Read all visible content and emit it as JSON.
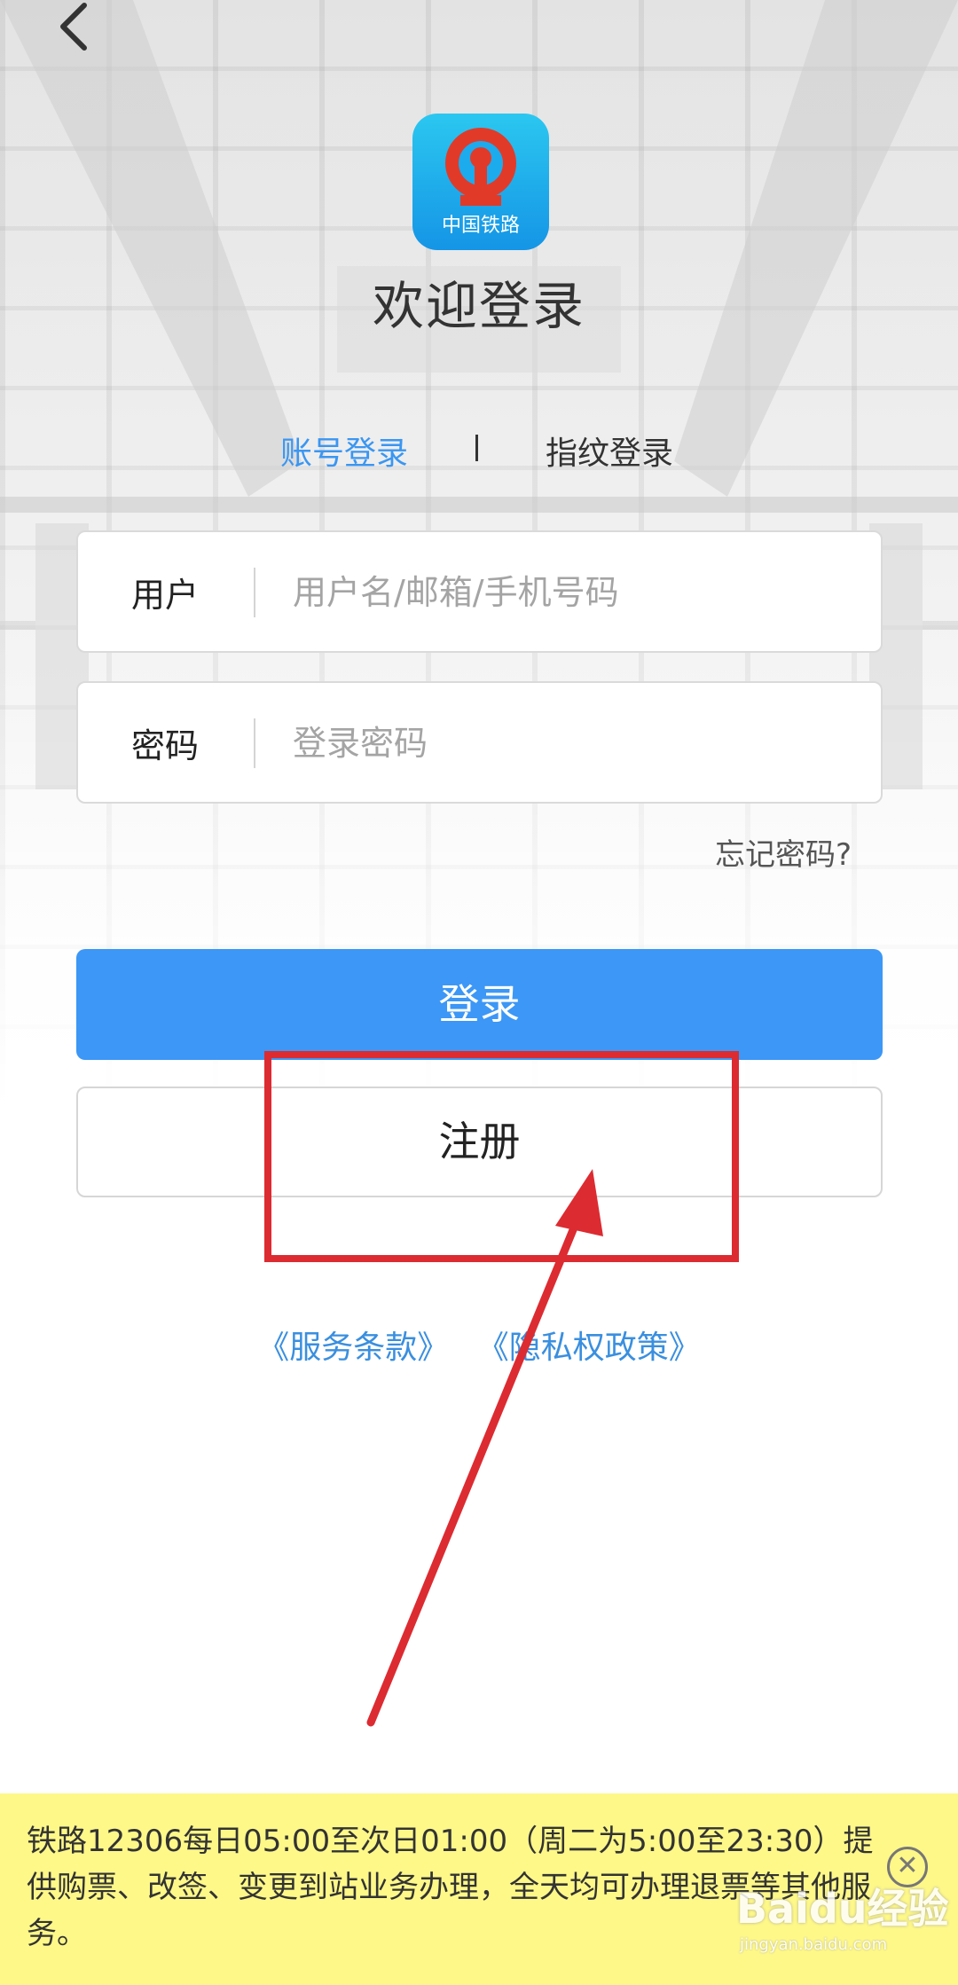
{
  "header": {
    "back_icon": "chevron-left-icon",
    "logo_icon": "china-railway-logo-icon",
    "logo_caption": "中国铁路",
    "title": "欢迎登录"
  },
  "tabs": [
    {
      "label": "账号登录",
      "active": true
    },
    {
      "label": "指纹登录",
      "active": false
    }
  ],
  "form": {
    "user_label": "用户",
    "user_placeholder": "用户名/邮箱/手机号码",
    "user_value": "",
    "password_label": "密码",
    "password_placeholder": "登录密码",
    "password_value": "",
    "forgot_label": "忘记密码?"
  },
  "buttons": {
    "login": "登录",
    "register": "注册"
  },
  "links": {
    "terms": "《服务条款》",
    "privacy": "《隐私权政策》"
  },
  "notice": {
    "text": "铁路12306每日05:00至次日01:00（周二为5:00至23:30）提供购票、改签、变更到站业务办理，全天均可办理退票等其他服务。",
    "close_icon": "close-circle-icon"
  },
  "watermark": {
    "brand": "Baidu经验",
    "url": "jingyan.baidu.com"
  },
  "colors": {
    "accent": "#3c97f6",
    "tab_active": "#3a96f2",
    "link": "#3a8fdf",
    "notice_bg": "#fef888",
    "annotation": "#dc2b31"
  }
}
